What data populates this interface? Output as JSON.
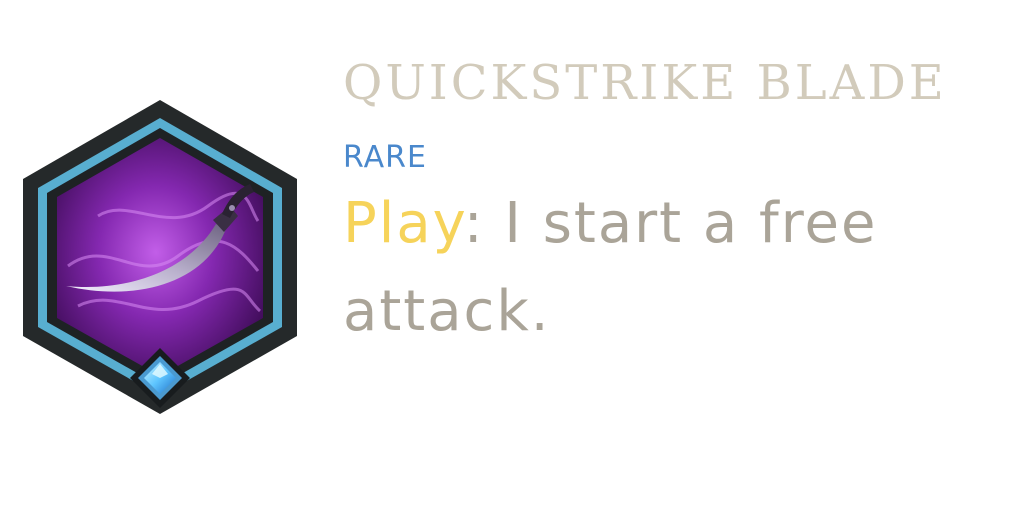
{
  "item": {
    "name": "QUICKSTRIKE BLADE",
    "rarity": "RARE",
    "keyword": "Play",
    "description": ": I start a free attack.",
    "icon": "curved-dagger-icon",
    "gem_icon": "diamond-gem-icon"
  },
  "colors": {
    "name": "#d2cbbb",
    "rarity": "#4a88cc",
    "keyword": "#f6d35a",
    "description": "#aaa498",
    "frame_outer": "#25292a",
    "frame_ring": "#58aed0",
    "art_background": "#6a1a88",
    "gem": "#5fc6ff"
  }
}
